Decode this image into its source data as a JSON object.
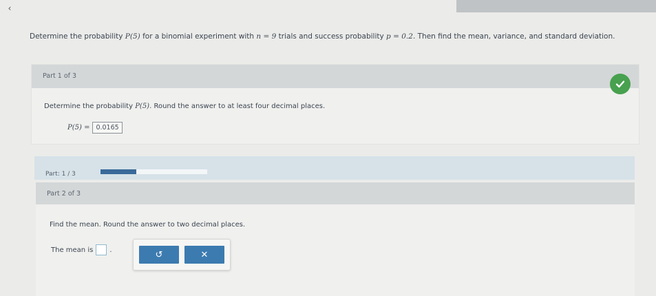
{
  "nav": {
    "back_glyph": "‹"
  },
  "problem": {
    "text_1": "Determine the probability ",
    "p5": "P(5)",
    "text_2": " for a binomial experiment with ",
    "n_eq": "n = 9",
    "text_3": " trials and success probability ",
    "p_eq": "p = 0.2",
    "text_4": ". Then find the mean, variance, and standard deviation."
  },
  "part1": {
    "label": "Part 1 of 3",
    "question_1": "Determine the probability ",
    "question_p5": "P(5)",
    "question_2": ". Round the answer to at least four decimal places.",
    "answer_prefix": "P(5) =",
    "answer_value": "0.0165",
    "status_icon": "check-icon",
    "status_color": "#47a14e"
  },
  "progress": {
    "label": "Part: 1 / 3",
    "fraction": 0.333,
    "fill_color": "#3a6a9a"
  },
  "part2": {
    "label": "Part 2 of 3",
    "question": "Find the mean. Round the answer to two decimal places.",
    "mean_label": "The mean is",
    "mean_value": "",
    "period": ".",
    "undo_glyph": "↺",
    "clear_glyph": "✕",
    "button_color": "#3c7bb0"
  }
}
